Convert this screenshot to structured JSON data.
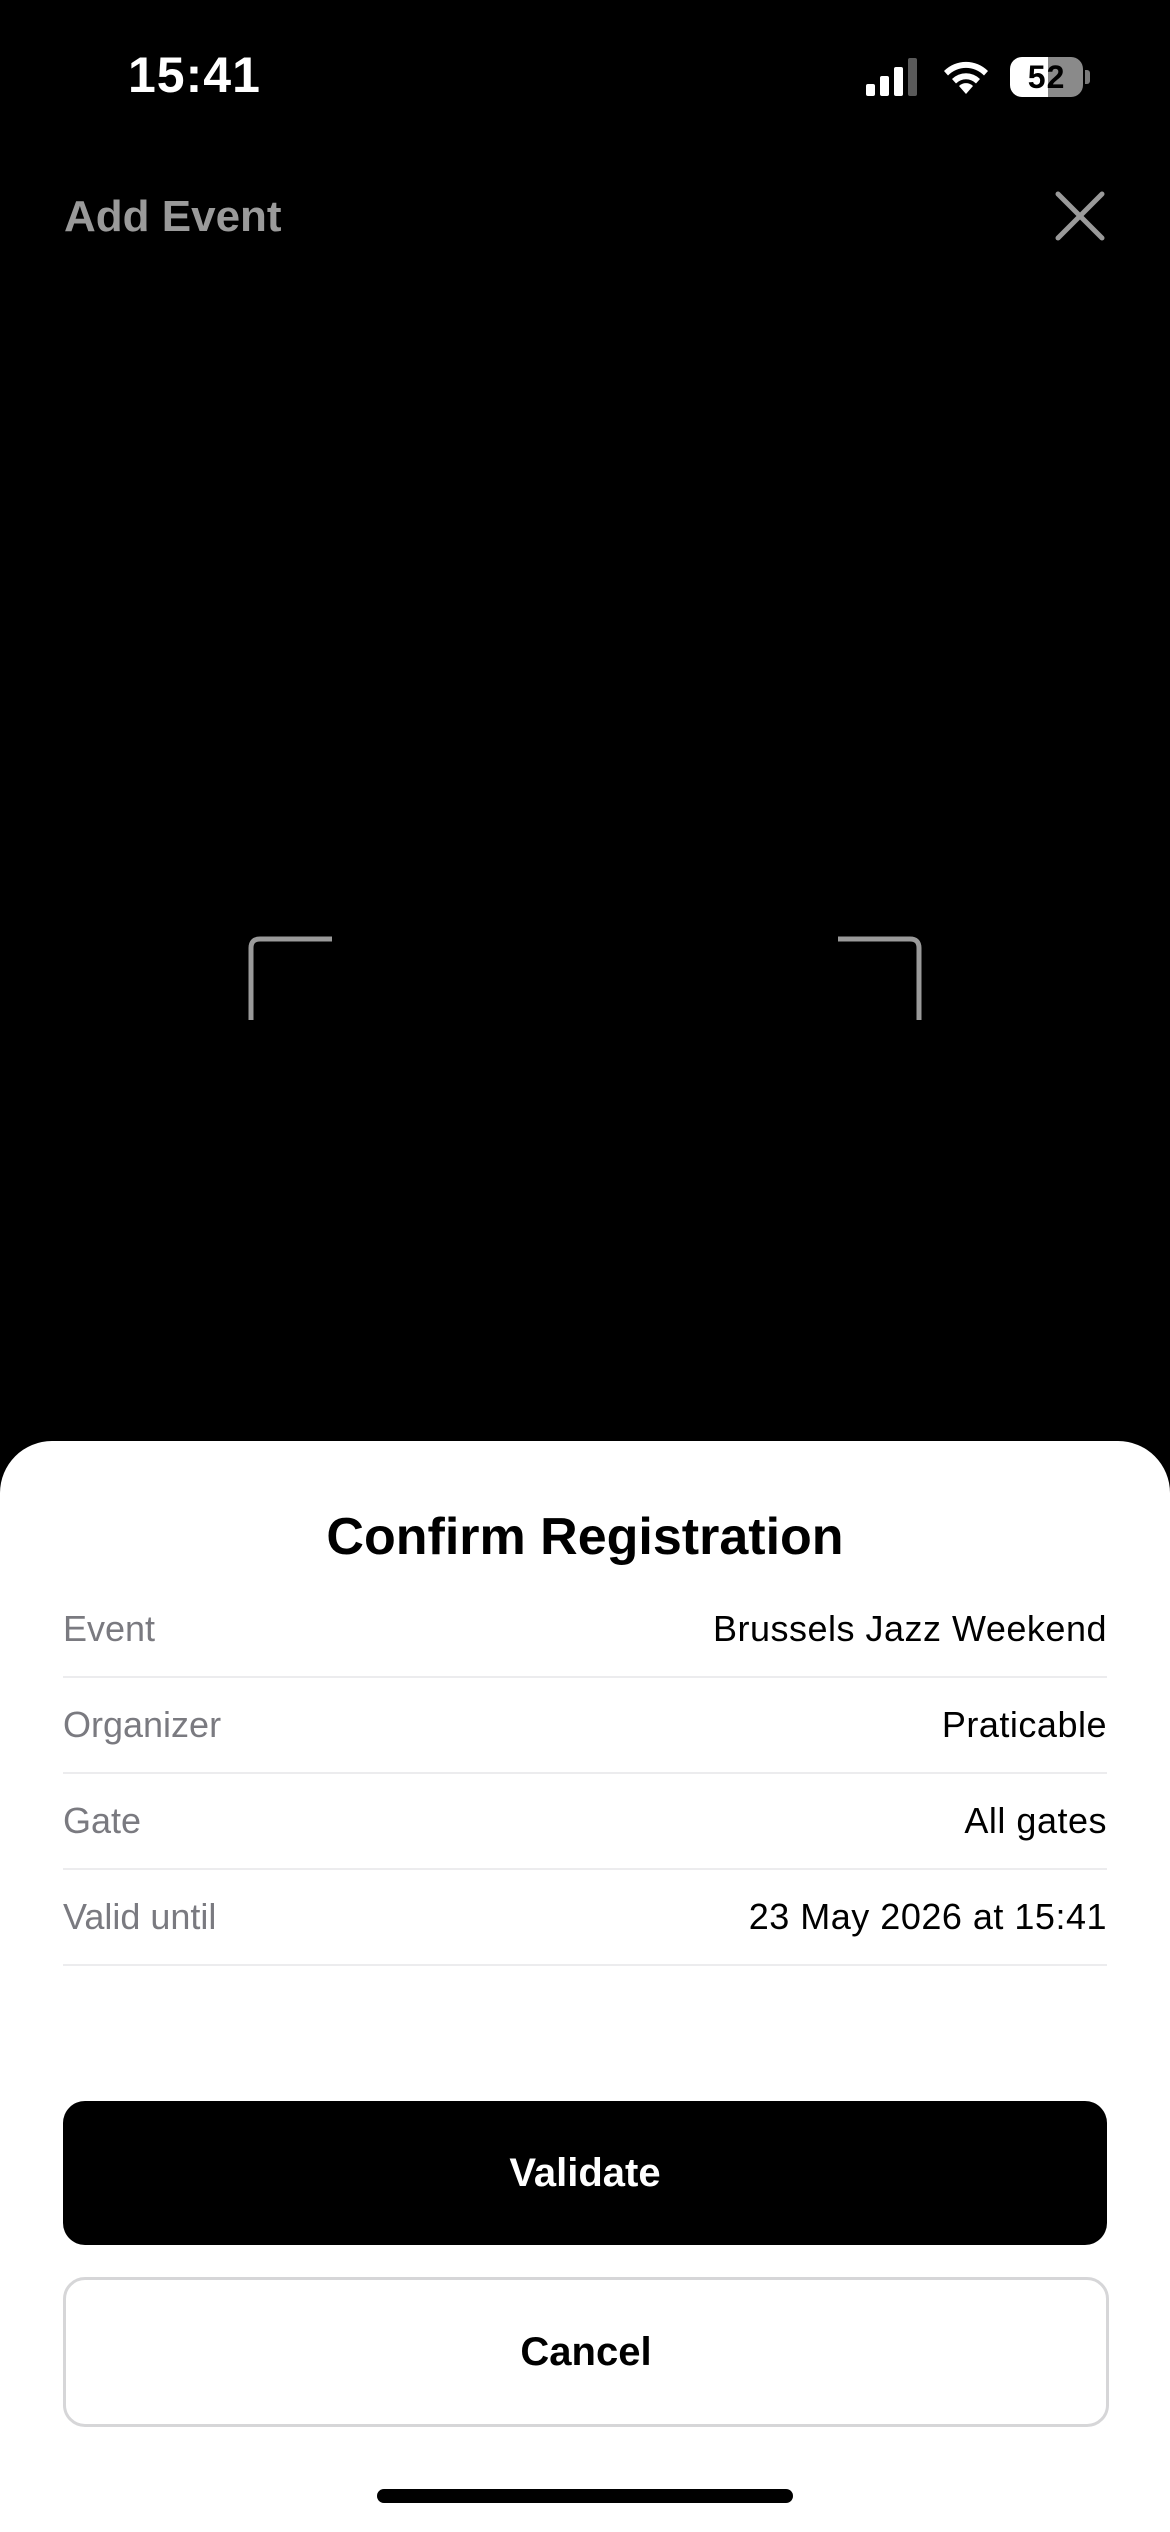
{
  "status_bar": {
    "time": "15:41",
    "battery": "52",
    "icons": [
      "cellular-signal-icon",
      "wifi-icon",
      "battery-icon"
    ]
  },
  "header": {
    "title": "Add Event",
    "close_icon": "close-icon"
  },
  "scanner": {
    "frame_icon": "scan-frame-corners"
  },
  "sheet": {
    "title": "Confirm Registration",
    "rows": [
      {
        "label": "Event",
        "value": "Brussels Jazz Weekend"
      },
      {
        "label": "Organizer",
        "value": "Praticable"
      },
      {
        "label": "Gate",
        "value": "All gates"
      },
      {
        "label": "Valid until",
        "value": "23 May 2026 at 15:41"
      }
    ],
    "validate_label": "Validate",
    "cancel_label": "Cancel"
  },
  "colors": {
    "background": "#000000",
    "sheet": "#ffffff",
    "primary_button": "#000000",
    "label_gray": "#7a7a80",
    "header_gray": "#9a9a9a"
  }
}
